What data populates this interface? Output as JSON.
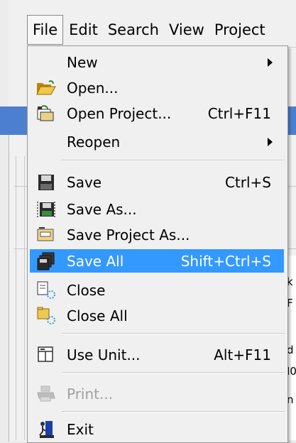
{
  "menubar": {
    "items": [
      "File",
      "Edit",
      "Search",
      "View",
      "Project"
    ]
  },
  "menu": {
    "new": {
      "label": "New"
    },
    "open": {
      "label": "Open..."
    },
    "open_project": {
      "label": "Open Project...",
      "shortcut": "Ctrl+F11"
    },
    "reopen": {
      "label": "Reopen"
    },
    "save": {
      "label": "Save",
      "shortcut": "Ctrl+S"
    },
    "save_as": {
      "label": "Save As..."
    },
    "save_project_as": {
      "label": "Save Project As..."
    },
    "save_all": {
      "label": "Save All",
      "shortcut": "Shift+Ctrl+S"
    },
    "close": {
      "label": "Close"
    },
    "close_all": {
      "label": "Close All"
    },
    "use_unit": {
      "label": "Use Unit...",
      "shortcut": "Alt+F11"
    },
    "print": {
      "label": "Print..."
    },
    "exit": {
      "label": "Exit"
    }
  },
  "background": {
    "frag1": "k",
    "frag2": "F",
    "frag3": "d",
    "frag4": "I0",
    "frag5": "n"
  },
  "colors": {
    "highlight": "#3399ff",
    "titlebar": "#4c7fd0"
  }
}
